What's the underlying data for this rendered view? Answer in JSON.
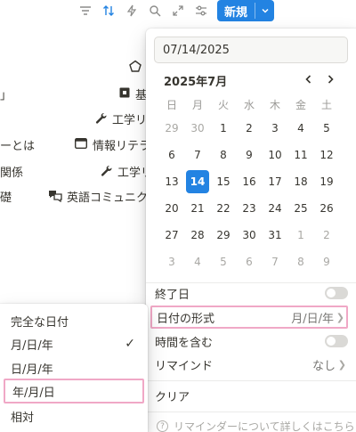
{
  "toolbar": {
    "icons": [
      "filter-icon",
      "sort-icon",
      "automation-icon",
      "search-icon",
      "expand-icon",
      "settings-icon"
    ],
    "new_label": "新規"
  },
  "board": {
    "items": [
      {
        "label": "」"
      },
      {
        "label": "基"
      },
      {
        "label": "工学リ"
      },
      {
        "label": "ーとは"
      },
      {
        "label": "情報リテラ"
      },
      {
        "label": "関係"
      },
      {
        "label": "工学リ"
      },
      {
        "label": "礎"
      },
      {
        "label": "英語コミュニク"
      }
    ]
  },
  "date_picker": {
    "input_value": "07/14/2025",
    "month_title": "2025年7月",
    "weekdays": [
      "日",
      "月",
      "火",
      "水",
      "木",
      "金",
      "土"
    ],
    "weeks": [
      [
        "29",
        "30",
        "1",
        "2",
        "3",
        "4",
        "5"
      ],
      [
        "6",
        "7",
        "8",
        "9",
        "10",
        "11",
        "12"
      ],
      [
        "13",
        "14",
        "15",
        "16",
        "17",
        "18",
        "19"
      ],
      [
        "20",
        "21",
        "22",
        "23",
        "24",
        "25",
        "26"
      ],
      [
        "27",
        "28",
        "29",
        "30",
        "31",
        "1",
        "2"
      ],
      [
        "3",
        "4",
        "5",
        "6",
        "7",
        "8",
        "9"
      ]
    ],
    "selected_day": "14",
    "end_date_label": "終了日",
    "date_format_label": "日付の形式",
    "date_format_value": "月/日/年",
    "include_time_label": "時間を含む",
    "reminder_label": "リマインド",
    "reminder_value": "なし",
    "clear_label": "クリア",
    "help_text": "リマインダーについて詳しくはこちら"
  },
  "format_menu": {
    "options": [
      "完全な日付",
      "月/日/年",
      "日/月/年",
      "年/月/日",
      "相対"
    ],
    "checked_option": "月/日/年",
    "highlighted_option": "年/月/日"
  },
  "colors": {
    "accent": "#2383e2",
    "highlight_border": "#f0a8c6"
  }
}
